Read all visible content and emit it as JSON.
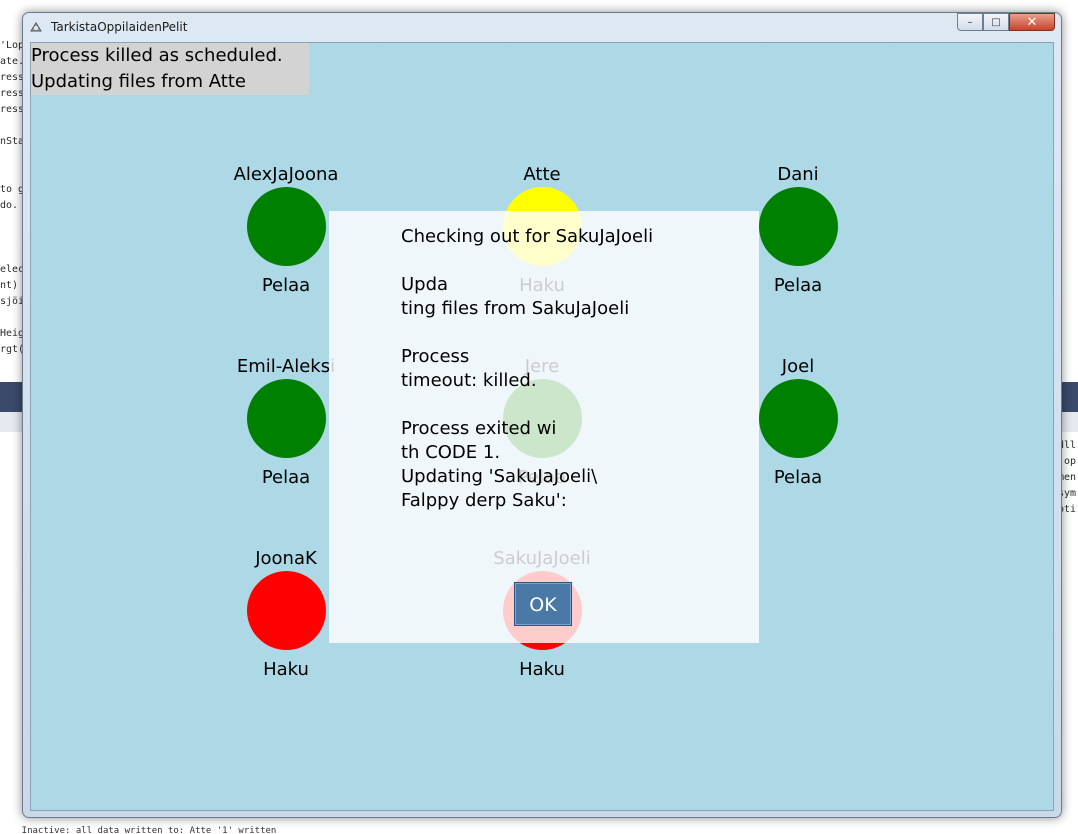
{
  "window": {
    "title": "TarkistaOppilaidenPelit",
    "buttons": {
      "minimize": "–",
      "maximize": "□",
      "close": "✕"
    }
  },
  "status": {
    "lines": [
      "Process killed as scheduled.",
      "Updating files from Atte"
    ]
  },
  "players": [
    {
      "name": "AlexJaJoona",
      "state": "Pelaa",
      "color": "#008000"
    },
    {
      "name": "Atte",
      "state": "Haku",
      "color": "#ffff00"
    },
    {
      "name": "Dani",
      "state": "Pelaa",
      "color": "#008000"
    },
    {
      "name": "Emil-Aleksi",
      "state": "Pelaa",
      "color": "#008000"
    },
    {
      "name": "Jere",
      "state": "Pelaa",
      "color": "#008000"
    },
    {
      "name": "Joel",
      "state": "Pelaa",
      "color": "#008000"
    },
    {
      "name": "JoonaK",
      "state": "Haku",
      "color": "#ff0000"
    },
    {
      "name": "SakuJaJoeli",
      "state": "Haku",
      "color": "#ff0000"
    }
  ],
  "dialog": {
    "text": "Checking out for SakuJaJoeli\n\nUpda\nting files from SakuJaJoeli\n\nProcess\ntimeout: killed.\n\nProcess exited wi\nth CODE 1.\nUpdating 'SakuJaJoeli\\\nFalppy derp Saku':",
    "ok_label": "OK"
  },
  "background": {
    "left_code": "'Lop\nate.\nress\nress\nress\n\nnSta\n\n\nto g\ndo.\n\n\n\nelec\nnt)\nsjöi\n\nHeig\nrgt(\n",
    "right_code": "dll\n op\nmen\nsym\npti",
    "bottom_code": "    Inactive: all data written to: Atte '1' written"
  },
  "colors": {
    "client_bg": "#add8e6",
    "status_bg": "#d3d3d3",
    "ok_button": "#4a79a8"
  }
}
